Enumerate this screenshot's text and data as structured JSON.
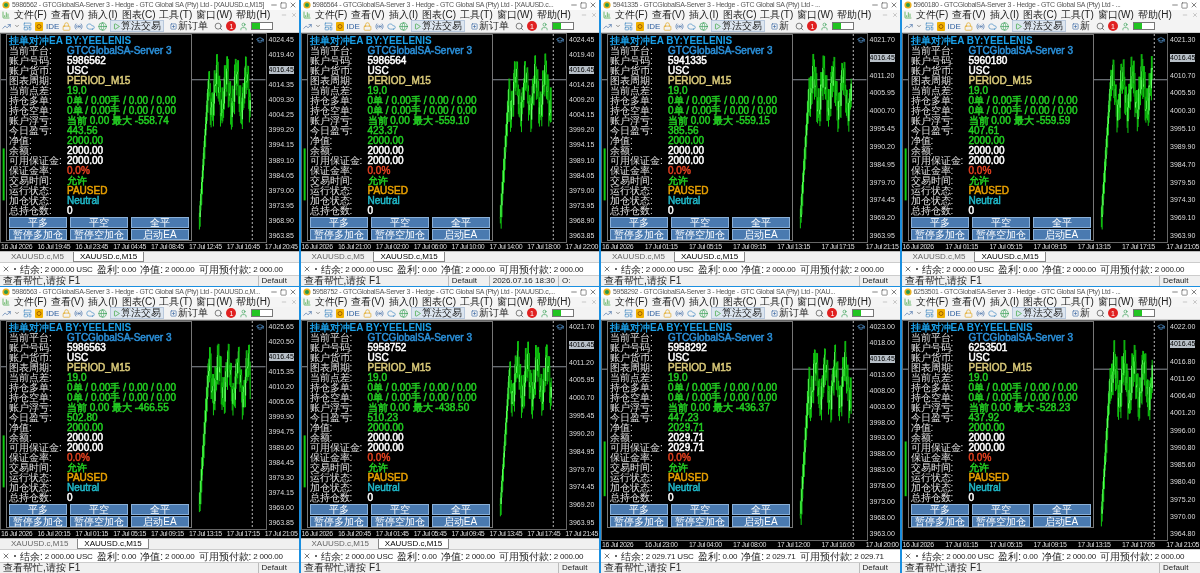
{
  "windows": [
    {
      "title": "5986562 - GTCGlobalSA-Server 3 - Hedge - GTC Global SA (Pty) Ltd - [XAUUSD.c,M15]",
      "menu": [
        "文件(F)",
        "查看(V)",
        "插入(I)",
        "图表(C)",
        "工具(T)",
        "窗口(W)",
        "帮助(H)"
      ],
      "toolbar": {
        "ide": "IDE",
        "algo_trading": "算法交易",
        "new_order": "新订单",
        "alert_count": "1"
      },
      "ea_panel": {
        "title": "挂单对冲EA BY:YEELENIS",
        "rows": [
          {
            "label": "当前平台:",
            "value": "GTCGlobalSA-Server 3",
            "color": "#2a8fd8"
          },
          {
            "label": "账户号码:",
            "value": "5986562",
            "color": "#ffffff"
          },
          {
            "label": "账户货币:",
            "value": "USC",
            "color": "#ffffff"
          },
          {
            "label": "图表周期:",
            "value": "PERIOD_M15",
            "color": "#d8c878"
          },
          {
            "label": "当前点差:",
            "value": "19.0",
            "color": "#22cc22"
          },
          {
            "label": "持仓多单:",
            "value": "0单 / 0.00手 / 0.00 / 0.00",
            "color": "#22cc22"
          },
          {
            "label": "持仓空单:",
            "value": "0单 / 0.00手 / 0.00 / 0.00",
            "color": "#22cc22"
          },
          {
            "label": "账户浮亏:",
            "value": "当前 0.00 最大 -558.74",
            "color": "#22cc22"
          },
          {
            "label": "今日盈亏:",
            "value": "443.56",
            "color": "#22cc22"
          },
          {
            "label": "净值:",
            "value": "2000.00",
            "color": "#22cc22"
          },
          {
            "label": "余额:",
            "value": "2000.00",
            "color": "#ffffff"
          },
          {
            "label": "可用保证金:",
            "value": "2000.00",
            "color": "#ffffff"
          },
          {
            "label": "保证金率:",
            "value": "0.0%",
            "color": "#e04020"
          },
          {
            "label": "交易时间:",
            "value": "允许",
            "color": "#22cc22"
          },
          {
            "label": "运行状态:",
            "value": "PAUSED",
            "color": "#e8a000"
          },
          {
            "label": "加仓状态:",
            "value": "Neutral",
            "color": "#20b8c8"
          },
          {
            "label": "总持仓数:",
            "value": "0",
            "color": "#ffffff"
          }
        ],
        "buttons": [
          "平多",
          "平空",
          "全平",
          "暂停多加仓",
          "暂停空加仓",
          "启动EA"
        ]
      },
      "chart": {
        "price_labels": [
          "4024.45",
          "4019.40",
          "4014.35",
          "4009.30",
          "4004.25",
          "3999.20",
          "3994.15",
          "3989.10",
          "3984.05",
          "3979.00",
          "3973.95",
          "3968.90",
          "3963.85"
        ],
        "price_tag": "4016.45",
        "time_labels": [
          "16 Jul 2026",
          "16 Jul 19:45",
          "16 Jul 23:45",
          "17 Jul 04:45",
          "17 Jul 08:45",
          "17 Jul 12:45",
          "17 Jul 16:45",
          "17 Jul 20:45"
        ]
      },
      "tabs": [
        {
          "label": "XAUUSD.c,M5",
          "selected": false
        },
        {
          "label": "XAUUSD.c,M15",
          "selected": true
        }
      ],
      "toolbox": [
        {
          "label": "结余:",
          "value": "2 000.00 USC"
        },
        {
          "label": "盈利:",
          "value": "0.00"
        },
        {
          "label": "净值:",
          "value": "2 000.00"
        },
        {
          "label": "可用预付款:",
          "value": "2 000.00"
        }
      ],
      "status": [
        "查看帮忙,请按 F1",
        "Default"
      ]
    },
    {
      "title": "5986564 - GTCGlobalSA-Server 3 - Hedge - GTC Global SA (Pty) Ltd - [XAUUSD.c...",
      "menu": [
        "文件(F)",
        "查看(V)",
        "插入(I)",
        "图表(C)",
        "工具(T)",
        "窗口(W)",
        "帮助(H)"
      ],
      "toolbar": {
        "ide": "IDE",
        "algo_trading": "算法交易",
        "new_order": "新订单",
        "alert_count": "1"
      },
      "ea_panel": {
        "title": "挂单对冲EA BY:YEELENIS",
        "rows": [
          {
            "label": "当前平台:",
            "value": "GTCGlobalSA-Server 3",
            "color": "#2a8fd8"
          },
          {
            "label": "账户号码:",
            "value": "5986564",
            "color": "#ffffff"
          },
          {
            "label": "账户货币:",
            "value": "USC",
            "color": "#ffffff"
          },
          {
            "label": "图表周期:",
            "value": "PERIOD_M15",
            "color": "#d8c878"
          },
          {
            "label": "当前点差:",
            "value": "19.0",
            "color": "#22cc22"
          },
          {
            "label": "持仓多单:",
            "value": "0单 / 0.00手 / 0.00 / 0.00",
            "color": "#22cc22"
          },
          {
            "label": "持仓空单:",
            "value": "0单 / 0.00手 / 0.00 / 0.00",
            "color": "#22cc22"
          },
          {
            "label": "账户浮亏:",
            "value": "当前 0.00 最大 -559.10",
            "color": "#22cc22"
          },
          {
            "label": "今日盈亏:",
            "value": "423.37",
            "color": "#22cc22"
          },
          {
            "label": "净值:",
            "value": "2000.00",
            "color": "#22cc22"
          },
          {
            "label": "余额:",
            "value": "2000.00",
            "color": "#ffffff"
          },
          {
            "label": "可用保证金:",
            "value": "2000.00",
            "color": "#ffffff"
          },
          {
            "label": "保证金率:",
            "value": "0.0%",
            "color": "#e04020"
          },
          {
            "label": "交易时间:",
            "value": "允许",
            "color": "#22cc22"
          },
          {
            "label": "运行状态:",
            "value": "PAUSED",
            "color": "#e8a000"
          },
          {
            "label": "加仓状态:",
            "value": "Neutral",
            "color": "#20b8c8"
          },
          {
            "label": "总持仓数:",
            "value": "0",
            "color": "#ffffff"
          }
        ],
        "buttons": [
          "平多",
          "平空",
          "全平",
          "暂停多加仓",
          "暂停空加仓",
          "启动EA"
        ]
      },
      "chart": {
        "price_labels": [
          "4024.45",
          "4019.40",
          "4014.26",
          "4009.20",
          "4004.15",
          "3999.20",
          "3994.15",
          "3989.10",
          "3984.05",
          "3979.00",
          "3973.95",
          "3968.90",
          "3963.85"
        ],
        "price_tag": "4016.45",
        "time_labels": [
          "16 Jul 2026",
          "16 Jul 21:00",
          "17 Jul 02:00",
          "17 Jul 06:00",
          "17 Jul 10:00",
          "17 Jul 14:00",
          "17 Jul 18:00",
          "17 Jul 22:00"
        ]
      },
      "tabs": [
        {
          "label": "XAUUSD.c,M5",
          "selected": false
        },
        {
          "label": "XAUUSD.c,M15",
          "selected": true
        }
      ],
      "toolbox": [
        {
          "label": "结余:",
          "value": "2 000.00 USC"
        },
        {
          "label": "盈利:",
          "value": "0.00"
        },
        {
          "label": "净值:",
          "value": "2 000.00"
        },
        {
          "label": "可用预付款:",
          "value": "2 000.00"
        }
      ],
      "status": [
        "查看帮忙,请按 F1",
        "Default",
        "2026.07.16 18:30",
        "O:"
      ]
    },
    {
      "title": "5941335 - GTCGlobalSA-Server 3 - Hedge - GTC Global SA (Pty) Ltd - ...",
      "menu": [
        "文件(F)",
        "查看(V)",
        "插入(I)",
        "图表(C)",
        "工具(T)",
        "窗口(W)",
        "帮助(H)"
      ],
      "toolbar": {
        "ide": "IDE",
        "algo_trading": "算法交易",
        "new_order": "新",
        "alert_count": "1"
      },
      "ea_panel": {
        "title": "挂单对冲EA BY:YEELENIS",
        "rows": [
          {
            "label": "当前平台:",
            "value": "GTCGlobalSA-Server 3",
            "color": "#2a8fd8"
          },
          {
            "label": "账户号码:",
            "value": "5941335",
            "color": "#ffffff"
          },
          {
            "label": "账户货币:",
            "value": "USC",
            "color": "#ffffff"
          },
          {
            "label": "图表周期:",
            "value": "PERIOD_M15",
            "color": "#d8c878"
          },
          {
            "label": "当前点差:",
            "value": "19.0",
            "color": "#22cc22"
          },
          {
            "label": "持仓多单:",
            "value": "0单 / 0.00手 / 0.00 / 0.00",
            "color": "#22cc22"
          },
          {
            "label": "持仓空单:",
            "value": "0单 / 0.00手 / 0.00 / 0.00",
            "color": "#22cc22"
          },
          {
            "label": "账户浮亏:",
            "value": "当前 0.00 最大 -559.15",
            "color": "#22cc22"
          },
          {
            "label": "今日盈亏:",
            "value": "385.56",
            "color": "#22cc22"
          },
          {
            "label": "净值:",
            "value": "2000.00",
            "color": "#22cc22"
          },
          {
            "label": "余额:",
            "value": "2000.00",
            "color": "#ffffff"
          },
          {
            "label": "可用保证金:",
            "value": "2000.00",
            "color": "#ffffff"
          },
          {
            "label": "保证金率:",
            "value": "0.0%",
            "color": "#e04020"
          },
          {
            "label": "交易时间:",
            "value": "允许",
            "color": "#22cc22"
          },
          {
            "label": "运行状态:",
            "value": "PAUSED",
            "color": "#e8a000"
          },
          {
            "label": "加仓状态:",
            "value": "Neutral",
            "color": "#20b8c8"
          },
          {
            "label": "总持仓数:",
            "value": "0",
            "color": "#ffffff"
          }
        ],
        "buttons": [
          "平多",
          "平空",
          "全平",
          "暂停多加仓",
          "暂停空加仓",
          "启动EA"
        ]
      },
      "chart": {
        "price_labels": [
          "4021.70",
          "4011.20",
          "4005.95",
          "4000.70",
          "3995.45",
          "3990.20",
          "3984.95",
          "3979.70",
          "3974.45",
          "3969.20",
          "3963.95"
        ],
        "price_tag": "4016.45",
        "time_labels": [
          "16 Jul 2026",
          "17 Jul 01:15",
          "17 Jul 05:15",
          "17 Jul 09:15",
          "17 Jul 13:15",
          "17 Jul 17:15",
          "17 Jul 21:15"
        ]
      },
      "tabs": [
        {
          "label": "XAUUSD.c,M5",
          "selected": false
        },
        {
          "label": "XAUUSD.c,M15",
          "selected": true
        }
      ],
      "toolbox": [
        {
          "label": "结余:",
          "value": "2 000.00 USC"
        },
        {
          "label": "盈利:",
          "value": "0.00"
        },
        {
          "label": "净值:",
          "value": "2 000.00"
        },
        {
          "label": "可用预付款:",
          "value": "2 000.00"
        }
      ],
      "status": [
        "查看帮忙,请按 F1",
        "Default"
      ]
    },
    {
      "title": "5960180 - GTCGlobalSA-Server 3 - Hedge - GTC Global SA (Pty) Ltd - ...",
      "menu": [
        "文件(F)",
        "查看(V)",
        "插入(I)",
        "图表(C)",
        "工具(T)",
        "窗口(W)",
        "帮助(H)"
      ],
      "toolbar": {
        "ide": "IDE",
        "algo_trading": "算法交易",
        "new_order": "新",
        "alert_count": "1"
      },
      "ea_panel": {
        "title": "挂单对冲EA BY:YEELENIS",
        "rows": [
          {
            "label": "当前平台:",
            "value": "GTCGlobalSA-Server 3",
            "color": "#2a8fd8"
          },
          {
            "label": "账户号码:",
            "value": "5960180",
            "color": "#ffffff"
          },
          {
            "label": "账户货币:",
            "value": "USC",
            "color": "#ffffff"
          },
          {
            "label": "图表周期:",
            "value": "PERIOD_M15",
            "color": "#d8c878"
          },
          {
            "label": "当前点差:",
            "value": "19.0",
            "color": "#22cc22"
          },
          {
            "label": "持仓多单:",
            "value": "0单 / 0.00手 / 0.00 / 0.00",
            "color": "#22cc22"
          },
          {
            "label": "持仓空单:",
            "value": "0单 / 0.00手 / 0.00 / 0.00",
            "color": "#22cc22"
          },
          {
            "label": "账户浮亏:",
            "value": "当前 0.00 最大 -559.59",
            "color": "#22cc22"
          },
          {
            "label": "今日盈亏:",
            "value": "407.61",
            "color": "#22cc22"
          },
          {
            "label": "净值:",
            "value": "2000.00",
            "color": "#22cc22"
          },
          {
            "label": "余额:",
            "value": "2000.00",
            "color": "#ffffff"
          },
          {
            "label": "可用保证金:",
            "value": "2000.00",
            "color": "#ffffff"
          },
          {
            "label": "保证金率:",
            "value": "0.0%",
            "color": "#e04020"
          },
          {
            "label": "交易时间:",
            "value": "允许",
            "color": "#22cc22"
          },
          {
            "label": "运行状态:",
            "value": "PAUSED",
            "color": "#e8a000"
          },
          {
            "label": "加仓状态:",
            "value": "Neutral",
            "color": "#20b8c8"
          },
          {
            "label": "总持仓数:",
            "value": "0",
            "color": "#ffffff"
          }
        ],
        "buttons": [
          "平多",
          "平空",
          "全平",
          "暂停多加仓",
          "暂停空加仓",
          "启动EA"
        ]
      },
      "chart": {
        "price_labels": [
          "4021.30",
          "4010.70",
          "4005.50",
          "4000.30",
          "3995.10",
          "3989.90",
          "3984.70",
          "3979.50",
          "3974.30",
          "3969.10",
          "3963.90"
        ],
        "price_tag": "4016.45",
        "time_labels": [
          "16 Jul 2026",
          "17 Jul 01:15",
          "17 Jul 05:15",
          "17 Jul 09:15",
          "17 Jul 13:15",
          "17 Jul 17:15",
          "17 Jul 21:05"
        ]
      },
      "tabs": [
        {
          "label": "XAUUSD.c,M5",
          "selected": false
        },
        {
          "label": "XAUUSD.c,M15",
          "selected": true
        }
      ],
      "toolbox": [
        {
          "label": "结余:",
          "value": "2 000.00 USC"
        },
        {
          "label": "盈利:",
          "value": "0.00"
        },
        {
          "label": "净值:",
          "value": "2 000.00"
        },
        {
          "label": "可用预付款:",
          "value": "2 000.00"
        }
      ],
      "status": [
        "查看帮忙,请按 F1",
        "Default"
      ]
    },
    {
      "title": "5986563 - GTCGlobalSA-Server 3 - Hedge - GTC Global SA (Pty) Ltd - [XAUUSD.c,M...",
      "menu": [
        "文件(F)",
        "查看(V)",
        "插入(I)",
        "图表(C)",
        "工具(T)",
        "窗口(W)",
        "帮助(H)"
      ],
      "toolbar": {
        "ide": "IDE",
        "algo_trading": "算法交易",
        "new_order": "新订单",
        "alert_count": "1"
      },
      "ea_panel": {
        "title": "挂单对冲EA BY:YEELENIS",
        "rows": [
          {
            "label": "当前平台:",
            "value": "GTCGlobalSA-Server 3",
            "color": "#2a8fd8"
          },
          {
            "label": "账户号码:",
            "value": "5986563",
            "color": "#ffffff"
          },
          {
            "label": "账户货币:",
            "value": "USC",
            "color": "#ffffff"
          },
          {
            "label": "图表周期:",
            "value": "PERIOD_M15",
            "color": "#d8c878"
          },
          {
            "label": "当前点差:",
            "value": "19.0",
            "color": "#22cc22"
          },
          {
            "label": "持仓多单:",
            "value": "0单 / 0.00手 / 0.00 / 0.00",
            "color": "#22cc22"
          },
          {
            "label": "持仓空单:",
            "value": "0单 / 0.00手 / 0.00 / 0.00",
            "color": "#22cc22"
          },
          {
            "label": "账户浮亏:",
            "value": "当前 0.00 最大 -466.55",
            "color": "#22cc22"
          },
          {
            "label": "今日盈亏:",
            "value": "502.80",
            "color": "#22cc22"
          },
          {
            "label": "净值:",
            "value": "2000.00",
            "color": "#22cc22"
          },
          {
            "label": "余额:",
            "value": "2000.00",
            "color": "#ffffff"
          },
          {
            "label": "可用保证金:",
            "value": "2000.00",
            "color": "#ffffff"
          },
          {
            "label": "保证金率:",
            "value": "0.0%",
            "color": "#e04020"
          },
          {
            "label": "交易时间:",
            "value": "允许",
            "color": "#22cc22"
          },
          {
            "label": "运行状态:",
            "value": "PAUSED",
            "color": "#e8a000"
          },
          {
            "label": "加仓状态:",
            "value": "Neutral",
            "color": "#20b8c8"
          },
          {
            "label": "总持仓数:",
            "value": "0",
            "color": "#ffffff"
          }
        ],
        "buttons": [
          "平多",
          "平空",
          "全平",
          "暂停多加仓",
          "暂停空加仓",
          "启动EA"
        ]
      },
      "chart": {
        "price_labels": [
          "4025.65",
          "4020.50",
          "4015.35",
          "4010.20",
          "4005.05",
          "3999.90",
          "3994.75",
          "3989.60",
          "3984.45",
          "3979.30",
          "3974.15",
          "3969.00",
          "3963.85"
        ],
        "price_tag": "4016.45",
        "time_labels": [
          "16 Jul 2026",
          "16 Jul 20:15",
          "17 Jul 01:15",
          "17 Jul 05:15",
          "17 Jul 09:15",
          "17 Jul 13:15",
          "17 Jul 17:15",
          "17 Jul 21:05"
        ]
      },
      "tabs": [
        {
          "label": "XAUUSD.c,M15",
          "selected": false
        },
        {
          "label": "XAUUSD.c,M15",
          "selected": true
        }
      ],
      "toolbox": [
        {
          "label": "结余:",
          "value": "2 000.00 USC"
        },
        {
          "label": "盈利:",
          "value": "0.00"
        },
        {
          "label": "净值:",
          "value": "2 000.00"
        },
        {
          "label": "可用预付款:",
          "value": "2 000.00"
        }
      ],
      "status": [
        "查看帮忙,请按 F1",
        "Default"
      ]
    },
    {
      "title": "5958752 - GTCGlobalSA-Server 3 - Hedge - GTC Global SA (Pty) Ltd - [XAUUSD.c,...",
      "menu": [
        "文件(F)",
        "查看(V)",
        "插入(I)",
        "图表(C)",
        "工具(T)",
        "窗口(W)",
        "帮助(H)"
      ],
      "toolbar": {
        "ide": "IDE",
        "algo_trading": "算法交易",
        "new_order": "新订单",
        "alert_count": "1"
      },
      "ea_panel": {
        "title": "挂单对冲EA BY:YEELENIS",
        "rows": [
          {
            "label": "当前平台:",
            "value": "GTCGlobalSA-Server 3",
            "color": "#2a8fd8"
          },
          {
            "label": "账户号码:",
            "value": "5958752",
            "color": "#ffffff"
          },
          {
            "label": "账户货币:",
            "value": "USC",
            "color": "#ffffff"
          },
          {
            "label": "图表周期:",
            "value": "PERIOD_M15",
            "color": "#d8c878"
          },
          {
            "label": "当前点差:",
            "value": "19.0",
            "color": "#22cc22"
          },
          {
            "label": "持仓多单:",
            "value": "0单 / 0.00手 / 0.00 / 0.00",
            "color": "#22cc22"
          },
          {
            "label": "持仓空单:",
            "value": "0单 / 0.00手 / 0.00 / 0.00",
            "color": "#22cc22"
          },
          {
            "label": "账户浮亏:",
            "value": "当前 0.00 最大 -438.50",
            "color": "#22cc22"
          },
          {
            "label": "今日盈亏:",
            "value": "510.23",
            "color": "#22cc22"
          },
          {
            "label": "净值:",
            "value": "2000.00",
            "color": "#22cc22"
          },
          {
            "label": "余额:",
            "value": "2000.00",
            "color": "#ffffff"
          },
          {
            "label": "可用保证金:",
            "value": "2000.00",
            "color": "#ffffff"
          },
          {
            "label": "保证金率:",
            "value": "0.0%",
            "color": "#e04020"
          },
          {
            "label": "交易时间:",
            "value": "允许",
            "color": "#22cc22"
          },
          {
            "label": "运行状态:",
            "value": "PAUSED",
            "color": "#e8a000"
          },
          {
            "label": "加仓状态:",
            "value": "Neutral",
            "color": "#20b8c8"
          },
          {
            "label": "总持仓数:",
            "value": "0",
            "color": "#ffffff"
          }
        ],
        "buttons": [
          "平多",
          "平空",
          "全平",
          "暂停多加仓",
          "暂停空加仓",
          "启动EA"
        ]
      },
      "chart": {
        "price_labels": [
          "4021.70",
          "4011.20",
          "4005.95",
          "4000.70",
          "3995.45",
          "3990.20",
          "3984.95",
          "3979.70",
          "3974.45",
          "3969.20",
          "3963.95"
        ],
        "price_tag": "4016.45",
        "time_labels": [
          "16 Jul 2026",
          "16 Jul 20:45",
          "17 Jul 01:45",
          "17 Jul 05:45",
          "17 Jul 09:45",
          "17 Jul 13:45",
          "17 Jul 17:45",
          "17 Jul 21:45"
        ]
      },
      "tabs": [
        {
          "label": "XAUUSD.c,M15",
          "selected": false
        },
        {
          "label": "XAUUSD.c,M15",
          "selected": true
        }
      ],
      "toolbox": [
        {
          "label": "结余:",
          "value": "2 000.00 USC"
        },
        {
          "label": "盈利:",
          "value": "0.00"
        },
        {
          "label": "净值:",
          "value": "2 000.00"
        },
        {
          "label": "可用预付款:",
          "value": "2 000.00"
        }
      ],
      "status": [
        "查看帮忙,请按 F1",
        "Default"
      ]
    },
    {
      "title": "5958292 - GTCGlobalSA-Server 3 - Hedge - GTC Global SA (Pty) Ltd - [XAU...",
      "menu": [
        "文件(F)",
        "查看(V)",
        "插入(I)",
        "图表(C)",
        "工具(T)",
        "窗口(W)",
        "帮助(H)"
      ],
      "toolbar": {
        "ide": "IDE",
        "algo_trading": "算法交易",
        "new_order": "新订单",
        "alert_count": "1"
      },
      "ea_panel": {
        "title": "挂单对冲EA BY:YEELENIS",
        "rows": [
          {
            "label": "当前平台:",
            "value": "GTCGlobalSA-Server 3",
            "color": "#2a8fd8"
          },
          {
            "label": "账户号码:",
            "value": "5958292",
            "color": "#ffffff"
          },
          {
            "label": "账户货币:",
            "value": "USC",
            "color": "#ffffff"
          },
          {
            "label": "图表周期:",
            "value": "PERIOD_M15",
            "color": "#d8c878"
          },
          {
            "label": "当前点差:",
            "value": "19.0",
            "color": "#22cc22"
          },
          {
            "label": "持仓多单:",
            "value": "0单 / 0.00手 / 0.00 / 0.00",
            "color": "#22cc22"
          },
          {
            "label": "持仓空单:",
            "value": "0单 / 0.00手 / 0.00 / 0.00",
            "color": "#22cc22"
          },
          {
            "label": "账户浮亏:",
            "value": "当前 0.00 最大 -436.37",
            "color": "#22cc22"
          },
          {
            "label": "今日盈亏:",
            "value": "447.23",
            "color": "#22cc22"
          },
          {
            "label": "净值:",
            "value": "2029.71",
            "color": "#22cc22"
          },
          {
            "label": "余额:",
            "value": "2029.71",
            "color": "#ffffff"
          },
          {
            "label": "可用保证金:",
            "value": "2029.71",
            "color": "#ffffff"
          },
          {
            "label": "保证金率:",
            "value": "0.0%",
            "color": "#e04020"
          },
          {
            "label": "交易时间:",
            "value": "允许",
            "color": "#22cc22"
          },
          {
            "label": "运行状态:",
            "value": "PAUSED",
            "color": "#e8a000"
          },
          {
            "label": "加仓状态:",
            "value": "Neutral",
            "color": "#20b8c8"
          },
          {
            "label": "总持仓数:",
            "value": "0",
            "color": "#ffffff"
          }
        ],
        "buttons": [
          "平多",
          "平空",
          "全平",
          "暂停多加仓",
          "暂停空加仓",
          "启动EA"
        ]
      },
      "chart": {
        "price_labels": [
          "4023.00",
          "4018.00",
          "4013.00",
          "4008.00",
          "4003.00",
          "3998.00",
          "3993.00",
          "3988.00",
          "3983.00",
          "3978.00",
          "3973.00",
          "3968.00",
          "3963.00"
        ],
        "price_tag": "4016.45",
        "time_labels": [
          "16 Jul 2026",
          "16 Jul 23:00",
          "17 Jul 04:00",
          "17 Jul 08:00",
          "17 Jul 12:00",
          "17 Jul 16:00",
          "17 Jul 20:00"
        ]
      },
      "toolbox": [
        {
          "label": "结余:",
          "value": "2 029.71 USC"
        },
        {
          "label": "盈利:",
          "value": "0.00"
        },
        {
          "label": "净值:",
          "value": "2 029.71"
        },
        {
          "label": "可用预付款:",
          "value": "2 029.71"
        }
      ],
      "status": [
        "查看帮忙,请按 F1",
        "Default"
      ]
    },
    {
      "title": "6253501 - GTCGlobalSA-Server 3 - Hedge - GTC Global SA (Pty) Ltd - ...",
      "menu": [
        "文件(F)",
        "查看(V)",
        "插入(I)",
        "图表(C)",
        "工具(T)",
        "窗口(W)",
        "帮助(H)"
      ],
      "toolbar": {
        "ide": "IDE",
        "algo_trading": "算法交易",
        "new_order": "新",
        "alert_count": "1"
      },
      "ea_panel": {
        "title": "挂单对冲EA BY:YEELENIS",
        "rows": [
          {
            "label": "当前平台:",
            "value": "GTCGlobalSA-Server 3",
            "color": "#2a8fd8"
          },
          {
            "label": "账户号码:",
            "value": "6253501",
            "color": "#ffffff"
          },
          {
            "label": "账户货币:",
            "value": "USC",
            "color": "#ffffff"
          },
          {
            "label": "图表周期:",
            "value": "PERIOD_M15",
            "color": "#d8c878"
          },
          {
            "label": "当前点差:",
            "value": "19.0",
            "color": "#22cc22"
          },
          {
            "label": "持仓多单:",
            "value": "0单 / 0.00手 / 0.00 / 0.00",
            "color": "#22cc22"
          },
          {
            "label": "持仓空单:",
            "value": "0单 / 0.00手 / 0.00 / 0.00",
            "color": "#22cc22"
          },
          {
            "label": "账户浮亏:",
            "value": "当前 0.00 最大 -528.23",
            "color": "#22cc22"
          },
          {
            "label": "今日盈亏:",
            "value": "437.92",
            "color": "#22cc22"
          },
          {
            "label": "净值:",
            "value": "2000.00",
            "color": "#22cc22"
          },
          {
            "label": "余额:",
            "value": "2000.00",
            "color": "#ffffff"
          },
          {
            "label": "可用保证金:",
            "value": "2000.00",
            "color": "#ffffff"
          },
          {
            "label": "保证金率:",
            "value": "0.0%",
            "color": "#e04020"
          },
          {
            "label": "交易时间:",
            "value": "允许",
            "color": "#22cc22"
          },
          {
            "label": "运行状态:",
            "value": "PAUSED",
            "color": "#e8a000"
          },
          {
            "label": "加仓状态:",
            "value": "Neutral",
            "color": "#20b8c8"
          },
          {
            "label": "总持仓数:",
            "value": "0",
            "color": "#ffffff"
          }
        ],
        "buttons": [
          "平多",
          "平空",
          "全平",
          "暂停多加仓",
          "暂停空加仓",
          "启动EA"
        ]
      },
      "chart": {
        "price_labels": [
          "4022.00",
          "4016.80",
          "4011.60",
          "4006.40",
          "4001.20",
          "3996.00",
          "3990.80",
          "3985.60",
          "3980.40",
          "3975.20",
          "3970.00",
          "3964.80"
        ],
        "price_tag": "4016.45",
        "time_labels": [
          "16 Jul 2026",
          "17 Jul 01:15",
          "17 Jul 05:15",
          "17 Jul 09:15",
          "17 Jul 13:15",
          "17 Jul 17:05",
          "17 Jul 21:05"
        ]
      },
      "toolbox": [
        {
          "label": "结余:",
          "value": "2 000.00 USC"
        },
        {
          "label": "盈利:",
          "value": "0.00"
        },
        {
          "label": "净值:",
          "value": "2 000.00"
        },
        {
          "label": "可用预付款:",
          "value": "2 000.00"
        }
      ],
      "status": [
        "查看帮忙,请按 F1",
        "Default"
      ]
    }
  ]
}
